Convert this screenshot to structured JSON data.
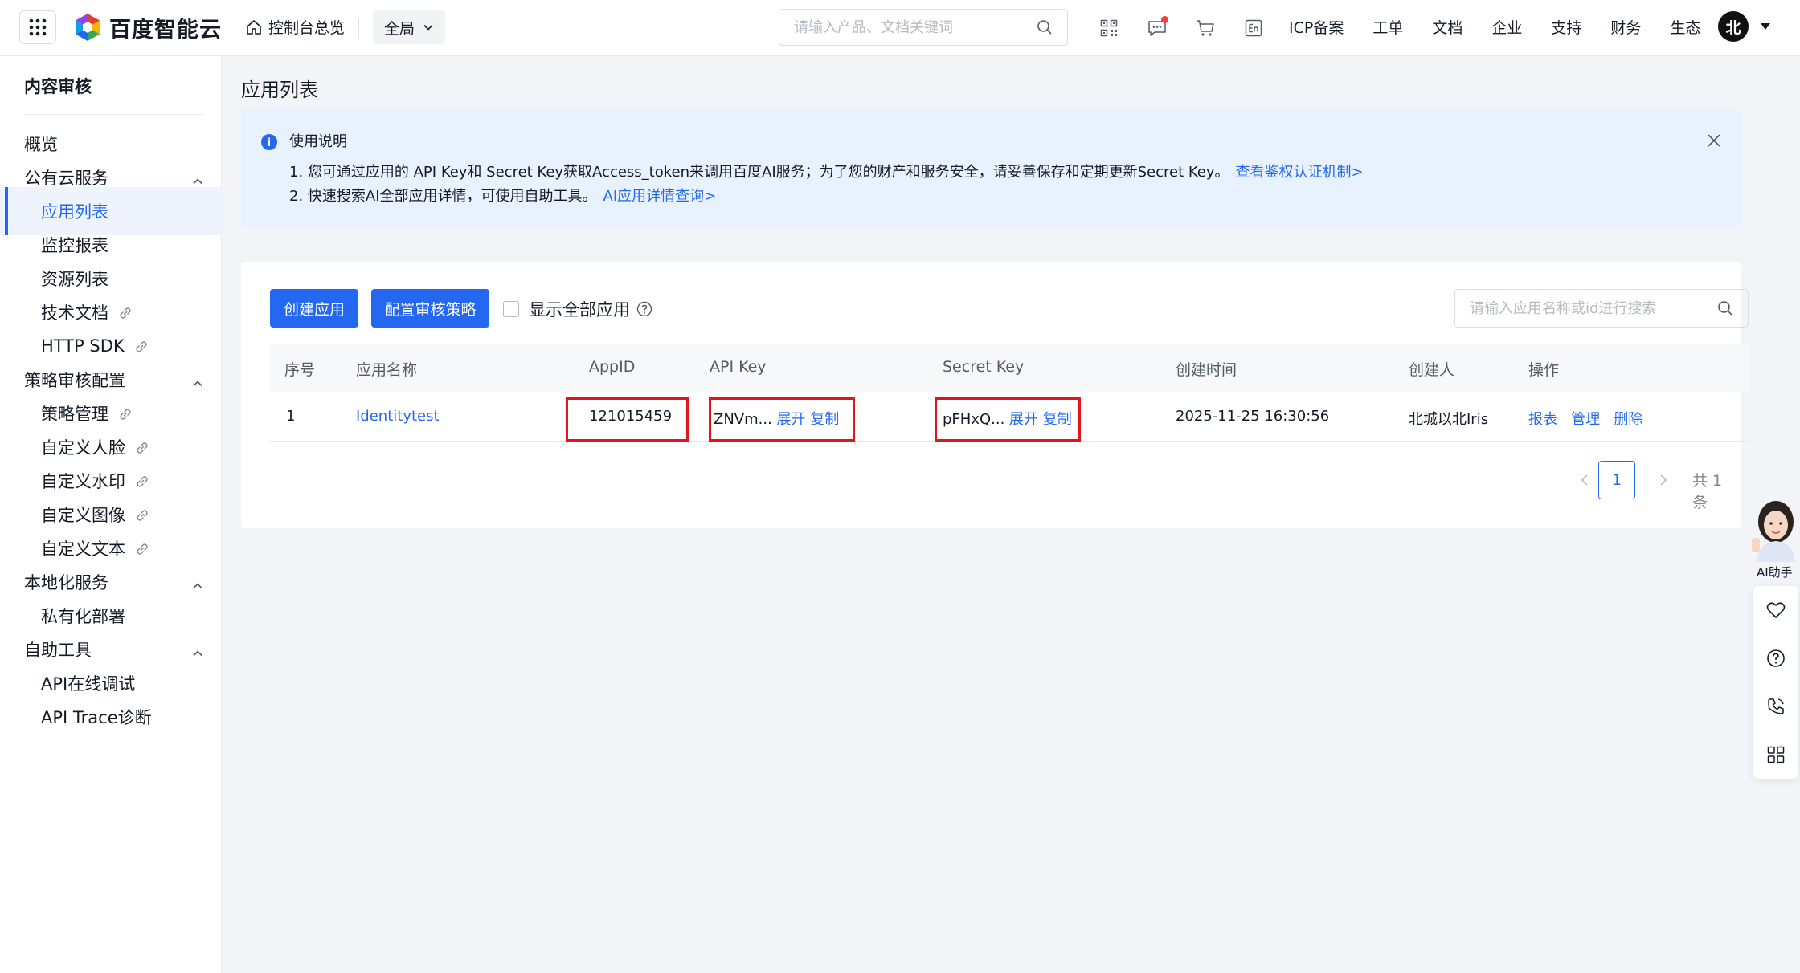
{
  "topbar": {
    "brand": "百度智能云",
    "home_label": "控制台总览",
    "scope": "全局",
    "search_placeholder": "请输入产品、文档关键词",
    "nav": [
      "ICP备案",
      "工单",
      "文档",
      "企业",
      "支持",
      "财务",
      "生态"
    ],
    "avatar_text": "北",
    "icons": [
      "qrcode-icon",
      "message-icon",
      "cart-icon",
      "language-en-icon"
    ]
  },
  "sidebar": {
    "title": "内容审核",
    "items": [
      {
        "label": "概览",
        "type": "group"
      },
      {
        "label": "公有云服务",
        "type": "group",
        "expandable": true
      },
      {
        "label": "应用列表",
        "type": "sub",
        "active": true
      },
      {
        "label": "监控报表",
        "type": "sub"
      },
      {
        "label": "资源列表",
        "type": "sub"
      },
      {
        "label": "技术文档",
        "type": "sub",
        "external": true
      },
      {
        "label": "HTTP SDK",
        "type": "sub",
        "external": true
      },
      {
        "label": "策略审核配置",
        "type": "group",
        "expandable": true
      },
      {
        "label": "策略管理",
        "type": "sub",
        "external": true
      },
      {
        "label": "自定义人脸",
        "type": "sub",
        "external": true
      },
      {
        "label": "自定义水印",
        "type": "sub",
        "external": true
      },
      {
        "label": "自定义图像",
        "type": "sub",
        "external": true
      },
      {
        "label": "自定义文本",
        "type": "sub",
        "external": true
      },
      {
        "label": "本地化服务",
        "type": "group",
        "expandable": true
      },
      {
        "label": "私有化部署",
        "type": "sub"
      },
      {
        "label": "自助工具",
        "type": "group",
        "expandable": true
      },
      {
        "label": "API在线调试",
        "type": "sub"
      },
      {
        "label": "API Trace诊断",
        "type": "sub"
      }
    ]
  },
  "main": {
    "page_title": "应用列表",
    "notice": {
      "title": "使用说明",
      "line1": "1. 您可通过应用的 API Key和 Secret Key获取Access_token来调用百度AI服务；为了您的财产和服务安全，请妥善保存和定期更新Secret Key。",
      "line1_link": "查看鉴权认证机制>",
      "line2": "2. 快速搜索AI全部应用详情，可使用自助工具。",
      "line2_link": "AI应用详情查询>"
    },
    "toolbar": {
      "create_label": "创建应用",
      "policy_label": "配置审核策略",
      "show_all_label": "显示全部应用",
      "search_placeholder": "请输入应用名称或id进行搜索"
    },
    "table": {
      "headers": [
        "序号",
        "应用名称",
        "AppID",
        "API Key",
        "Secret Key",
        "创建时间",
        "创建人",
        "操作"
      ],
      "rows": [
        {
          "index": "1",
          "name": "Identitytest",
          "appid": "121015459",
          "api_key": "ZNVm...",
          "secret_key": "pFHxQ...",
          "expand": "展开",
          "copy": "复制",
          "created": "2025-11-25 16:30:56",
          "creator": "北城以北Iris",
          "actions": [
            "报表",
            "管理",
            "删除"
          ]
        }
      ]
    },
    "pagination": {
      "current": "1",
      "total": "共 1 条"
    }
  },
  "float": {
    "ai_label": "AI助手"
  },
  "colors": {
    "accent": "#2468f2",
    "highlight": "#e3141e",
    "notice_bg": "#e8f1fe"
  }
}
